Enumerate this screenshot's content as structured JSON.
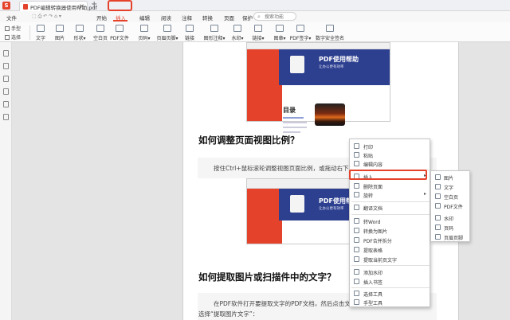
{
  "titlebar": {
    "app_logo": "S",
    "doc_tab": "PDF编辑转换器使用帮助.pdf",
    "close": "×",
    "new_tab": "+"
  },
  "menu": {
    "file": "文件",
    "tabs": [
      "开始",
      "插入",
      "编辑",
      "阅读",
      "注释",
      "转换",
      "页面",
      "保护"
    ],
    "active_tab": "插入",
    "search_placeholder": "搜索功能",
    "search_icon": "search-icon"
  },
  "toolbar": {
    "hand_tool": "手型",
    "select_tool": "选择",
    "tools": [
      "文字",
      "图片",
      "形状▾",
      "空白页",
      "PDF文件",
      "页码▾",
      "页眉页脚▾",
      "链接",
      "图形注释▾",
      "水印▾",
      "链接▾",
      "图章▾",
      "PDF签字▾",
      "数字安全签名"
    ]
  },
  "document": {
    "thumb_title": "PDF使用帮助",
    "thumb_subtitle": "让办公更有效率",
    "toc_title": "目录",
    "heading1": "如何调整页面视图比例？",
    "para1": "按住Ctrl+鼠标滚轮调整视图页面比例，或拖动右下",
    "heading2": "如何提取图片或扫描件中的文字？",
    "para2_line1": "在PDF软件打开要提取文字的PDF文档，然后点击文",
    "para2_line2": "选择“提取图片文字”："
  },
  "context_menu": {
    "items": [
      {
        "label": "打印",
        "icon": "printer-icon"
      },
      {
        "label": "粘贴",
        "icon": "paste-icon"
      },
      {
        "label": "编辑内容",
        "icon": "edit-icon"
      },
      {
        "label": "插入",
        "icon": "insert-icon",
        "submenu": true
      },
      {
        "label": "删除页面",
        "icon": "delete-page-icon"
      },
      {
        "label": "旋转",
        "icon": "rotate-icon",
        "submenu": true
      },
      {
        "label": "翻译文档",
        "icon": "translate-icon"
      },
      {
        "label": "转Word",
        "icon": "word-icon"
      },
      {
        "label": "转换为图片",
        "icon": "image-convert-icon"
      },
      {
        "label": "PDF合并拆分",
        "icon": "merge-icon"
      },
      {
        "label": "提取表格",
        "icon": "table-icon"
      },
      {
        "label": "提取当前页文字",
        "icon": "text-extract-icon"
      },
      {
        "label": "添加水印",
        "icon": "watermark-icon"
      },
      {
        "label": "插入书签",
        "icon": "bookmark-icon"
      },
      {
        "label": "选择工具",
        "icon": "select-icon"
      },
      {
        "label": "手型工具",
        "icon": "hand-icon"
      }
    ],
    "arrow": "▸",
    "highlighted": "插入"
  },
  "submenu": {
    "items": [
      "图片",
      "文字",
      "空白页",
      "PDF文件",
      "水印",
      "页码",
      "页眉页脚"
    ]
  },
  "colors": {
    "accent": "#e5422b",
    "brand_blue": "#2d3f8f"
  }
}
